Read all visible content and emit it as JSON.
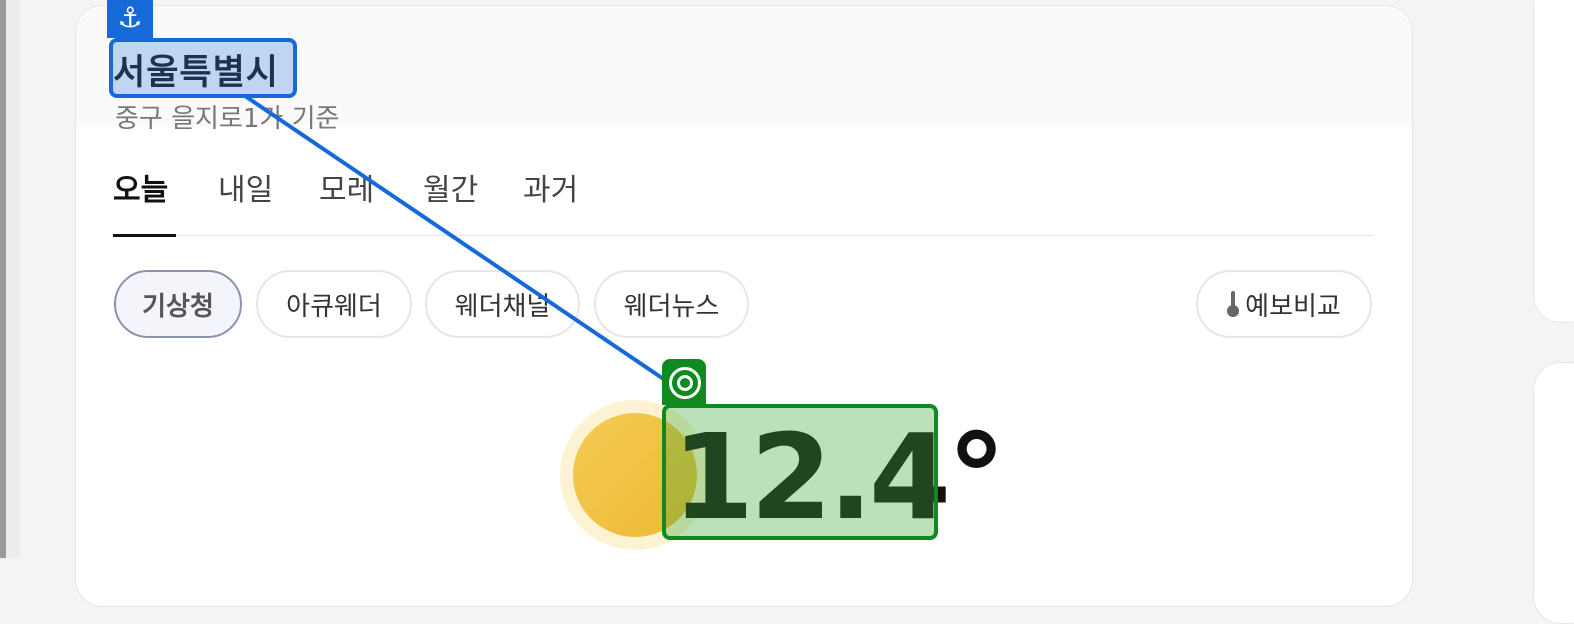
{
  "location": {
    "city": "서울특별시",
    "basis": "중구 을지로1가 기준"
  },
  "tabs": [
    {
      "label": "오늘",
      "active": true
    },
    {
      "label": "내일",
      "active": false
    },
    {
      "label": "모레",
      "active": false
    },
    {
      "label": "월간",
      "active": false
    },
    {
      "label": "과거",
      "active": false
    }
  ],
  "sources": [
    {
      "label": "기상청",
      "active": true
    },
    {
      "label": "아큐웨더",
      "active": false
    },
    {
      "label": "웨더채널",
      "active": false
    },
    {
      "label": "웨더뉴스",
      "active": false
    }
  ],
  "compare_button": {
    "label": "예보비교",
    "icon": "thermometer-icon"
  },
  "current": {
    "temperature": "12.4°",
    "condition_icon": "sun-icon"
  },
  "annotations": {
    "anchor_icon": "anchor-icon",
    "target_icon": "target-icon",
    "anchor_color": "#1669d9",
    "target_color": "#0f8a1f"
  }
}
